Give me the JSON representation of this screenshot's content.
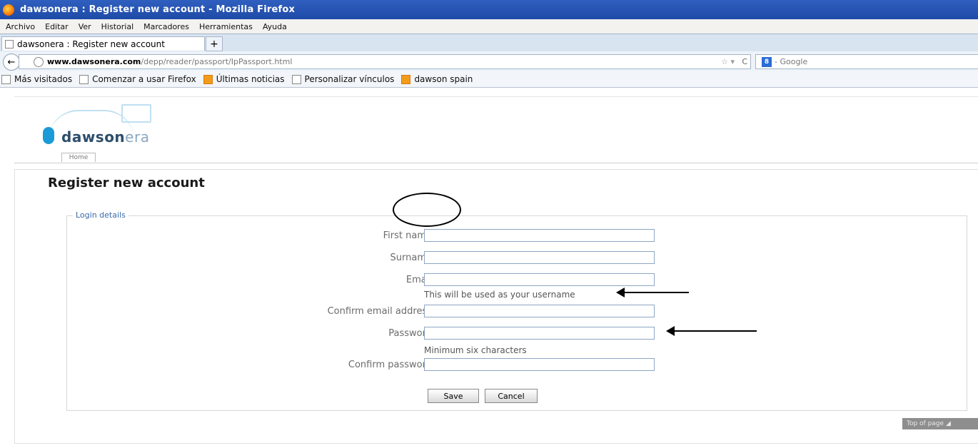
{
  "window": {
    "title": "dawsonera : Register new account - Mozilla Firefox"
  },
  "menu": [
    "Archivo",
    "Editar",
    "Ver",
    "Historial",
    "Marcadores",
    "Herramientas",
    "Ayuda"
  ],
  "tab": {
    "title": "dawsonera : Register new account",
    "new_tab_label": "+"
  },
  "address": {
    "domain": "www.dawsonera.com",
    "path": "/depp/reader/passport/IpPassport.html",
    "search_placeholder": "Google",
    "search_badge": "8"
  },
  "bookmarks": [
    {
      "label": "Más visitados",
      "icon": "page-icon"
    },
    {
      "label": "Comenzar a usar Firefox",
      "icon": "page-icon"
    },
    {
      "label": "Últimas noticias",
      "icon": "rss-icon"
    },
    {
      "label": "Personalizar vínculos",
      "icon": "page-icon"
    },
    {
      "label": "dawson spain",
      "icon": "rss-icon"
    }
  ],
  "site": {
    "logo_text_dark": "dawson",
    "logo_text_light": "era",
    "home_tab": "Home"
  },
  "page": {
    "title": "Register new account",
    "legend": "Login details",
    "fields": {
      "first_name": "First name",
      "surname": "Surname",
      "email": "Email",
      "email_hint": "This will be used as your username",
      "confirm_email": "Confirm email address",
      "password": "Password",
      "password_hint": "Minimum six characters",
      "confirm_password": "Confirm password"
    },
    "buttons": {
      "save": "Save",
      "cancel": "Cancel"
    },
    "top_of_page": "Top of page"
  }
}
